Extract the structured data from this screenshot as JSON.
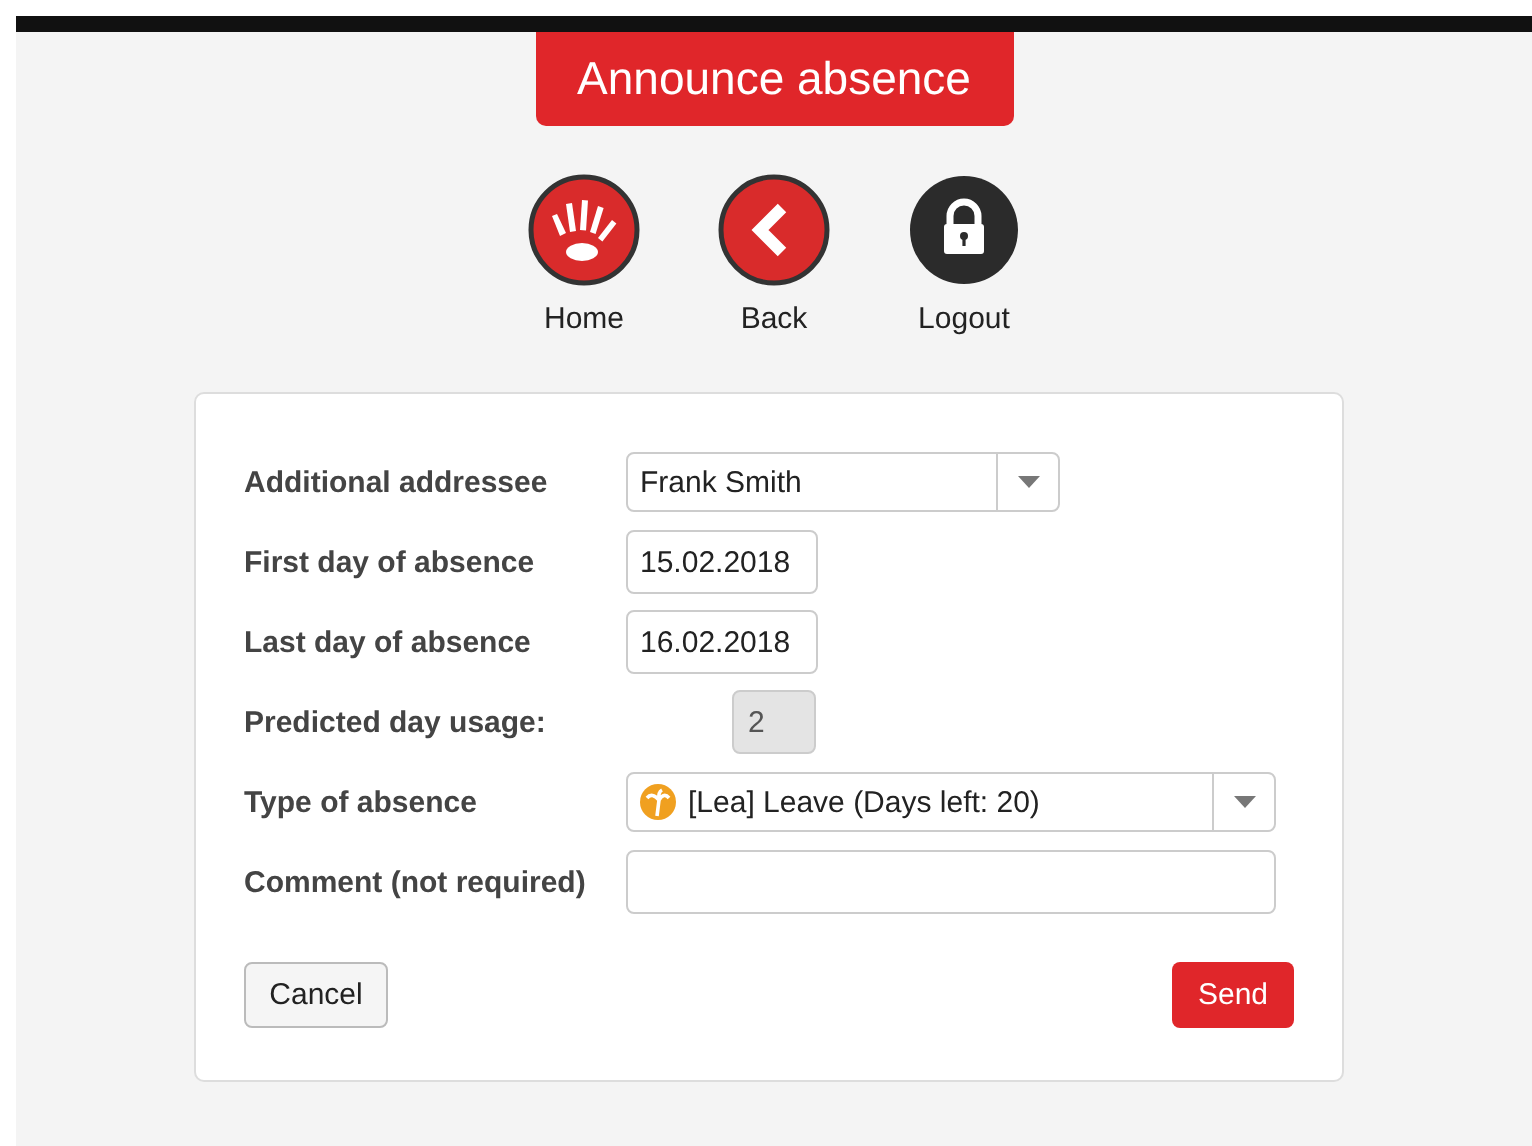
{
  "header": {
    "title": "Announce absence"
  },
  "nav": [
    {
      "label": "Home",
      "kind": "hand"
    },
    {
      "label": "Back",
      "kind": "back"
    },
    {
      "label": "Logout",
      "kind": "lock"
    }
  ],
  "form": {
    "rows": [
      {
        "label": "Additional addressee",
        "kind": "select",
        "value": "Frank Smith"
      },
      {
        "label": "First day of absence",
        "kind": "date",
        "value": "15.02.2018"
      },
      {
        "label": "Last day of absence",
        "kind": "date",
        "value": "16.02.2018"
      },
      {
        "label": "Predicted day usage:",
        "kind": "readonly",
        "value": "2"
      },
      {
        "label": "Type of absence",
        "kind": "select-icon",
        "value": "[Lea] Leave (Days left: 20)"
      },
      {
        "label": "Comment (not required)",
        "kind": "text"
      }
    ]
  },
  "buttons": {
    "cancel": "Cancel",
    "send": "Send"
  }
}
